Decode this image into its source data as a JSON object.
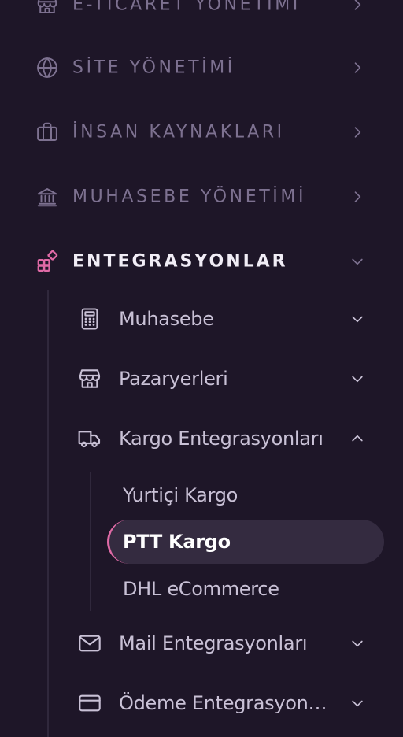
{
  "sections": [
    {
      "label": "E-TİCARET YÖNETİMİ",
      "icon": "store-icon",
      "expanded": false
    },
    {
      "label": "SİTE YÖNETİMİ",
      "icon": "globe-icon",
      "expanded": false
    },
    {
      "label": "İNSAN KAYNAKLARI",
      "icon": "briefcase-icon",
      "expanded": false
    },
    {
      "label": "MUHASEBE YÖNETİMİ",
      "icon": "bank-icon",
      "expanded": false
    },
    {
      "label": "ENTEGRASYONLAR",
      "icon": "apps-add-icon",
      "expanded": true
    }
  ],
  "integrations": {
    "items": [
      {
        "label": "Muhasebe",
        "icon": "calculator-icon",
        "expanded": false
      },
      {
        "label": "Pazaryerleri",
        "icon": "store-icon",
        "expanded": false
      },
      {
        "label": "Kargo Entegrasyonları",
        "icon": "truck-icon",
        "expanded": true
      },
      {
        "label": "Mail Entegrasyonları",
        "icon": "mail-icon",
        "expanded": false
      },
      {
        "label": "Ödeme Entegrasyonları",
        "icon": "credit-card-icon",
        "expanded": false
      }
    ],
    "cargo_children": [
      {
        "label": "Yurtiçi Kargo",
        "active": false
      },
      {
        "label": "PTT Kargo",
        "active": true
      },
      {
        "label": "DHL eCommerce",
        "active": false
      }
    ]
  },
  "colors": {
    "background": "#1e1628",
    "muted_text": "#7d7190",
    "active_accent": "#e06aa6",
    "active_bg": "#342b40"
  }
}
